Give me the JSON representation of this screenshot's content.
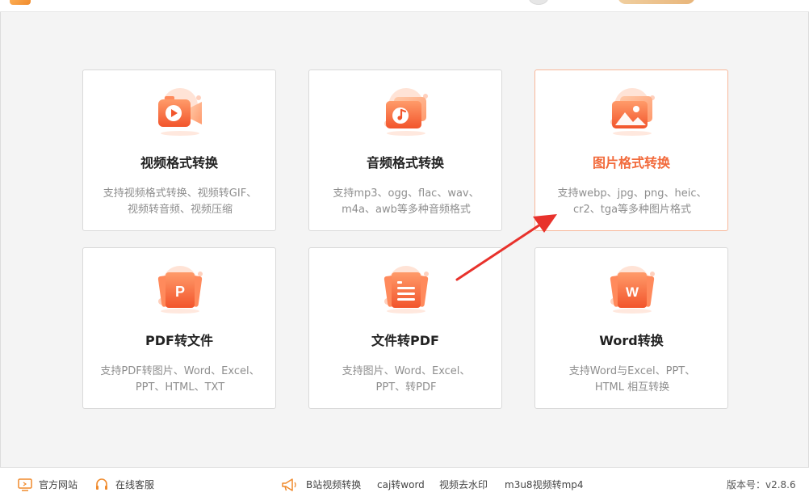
{
  "colors": {
    "accent": "#f26a3b",
    "card_border_active": "#f7b79a",
    "arrow": "#e8322c"
  },
  "cards": [
    {
      "title": "视频格式转换",
      "desc_line1": "支持视频格式转换、视频转GIF、",
      "desc_line2": "视频转音频、视频压缩",
      "icon": "video-camera-icon"
    },
    {
      "title": "音频格式转换",
      "desc_line1": "支持mp3、ogg、flac、wav、",
      "desc_line2": "m4a、awb等多种音频格式",
      "icon": "music-note-icon"
    },
    {
      "title": "图片格式转换",
      "desc_line1": "支持webp、jpg、png、heic、",
      "desc_line2": "cr2、tga等多种图片格式",
      "icon": "image-icon"
    },
    {
      "title": "PDF转文件",
      "desc_line1": "支持PDF转图片、Word、Excel、",
      "desc_line2": "PPT、HTML、TXT",
      "icon": "pdf-icon",
      "glyph": "P"
    },
    {
      "title": "文件转PDF",
      "desc_line1": "支持图片、Word、Excel、",
      "desc_line2": "PPT、转PDF",
      "icon": "document-icon"
    },
    {
      "title": "Word转换",
      "desc_line1": "支持Word与Excel、PPT、",
      "desc_line2": "HTML 相互转换",
      "icon": "word-icon",
      "glyph": "W"
    }
  ],
  "footer": {
    "website": "官方网站",
    "support": "在线客服",
    "links": [
      "B站视频转换",
      "caj转word",
      "视频去水印",
      "m3u8视频转mp4"
    ],
    "version": "版本号：v2.8.6"
  }
}
